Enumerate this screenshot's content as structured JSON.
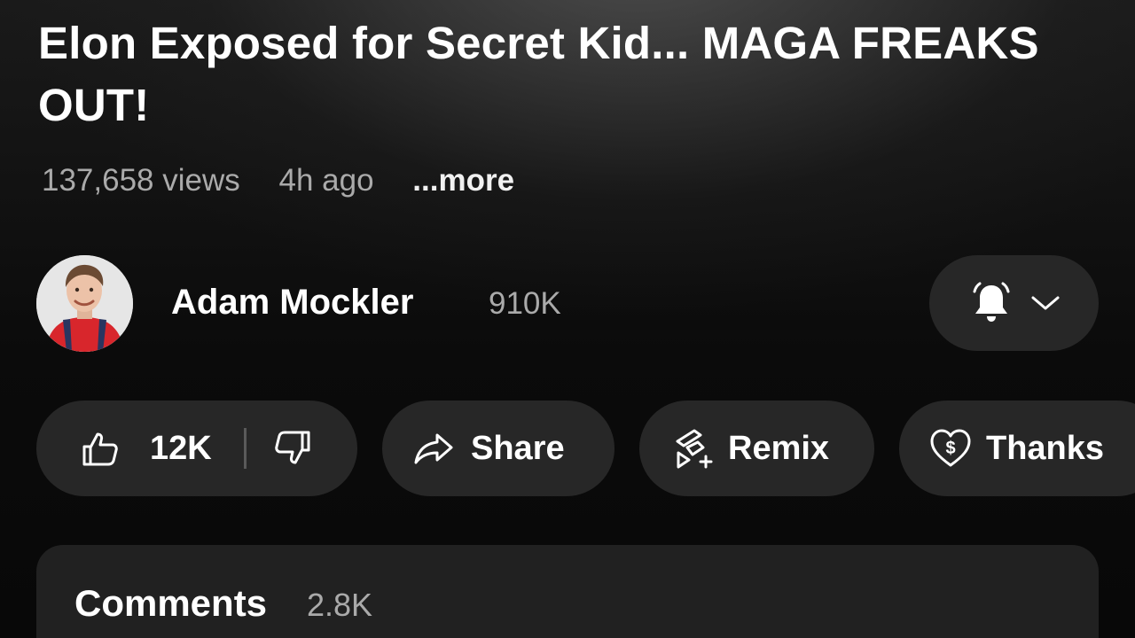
{
  "video": {
    "title": "Elon Exposed for Secret Kid... MAGA FREAKS OUT!",
    "views": "137,658 views",
    "age": "4h ago",
    "more_label": "...more"
  },
  "channel": {
    "name": "Adam Mockler",
    "subscribers": "910K",
    "avatar_icon": "channel-avatar",
    "notification_icon": "bell-icon"
  },
  "actions": {
    "like_count": "12K",
    "share_label": "Share",
    "remix_label": "Remix",
    "thanks_label": "Thanks"
  },
  "comments": {
    "title": "Comments",
    "count": "2.8K"
  },
  "colors": {
    "background": "#0f0f0f",
    "pill": "#272727",
    "card": "#212121",
    "text_primary": "#ffffff",
    "text_secondary": "#aaaaaa"
  }
}
